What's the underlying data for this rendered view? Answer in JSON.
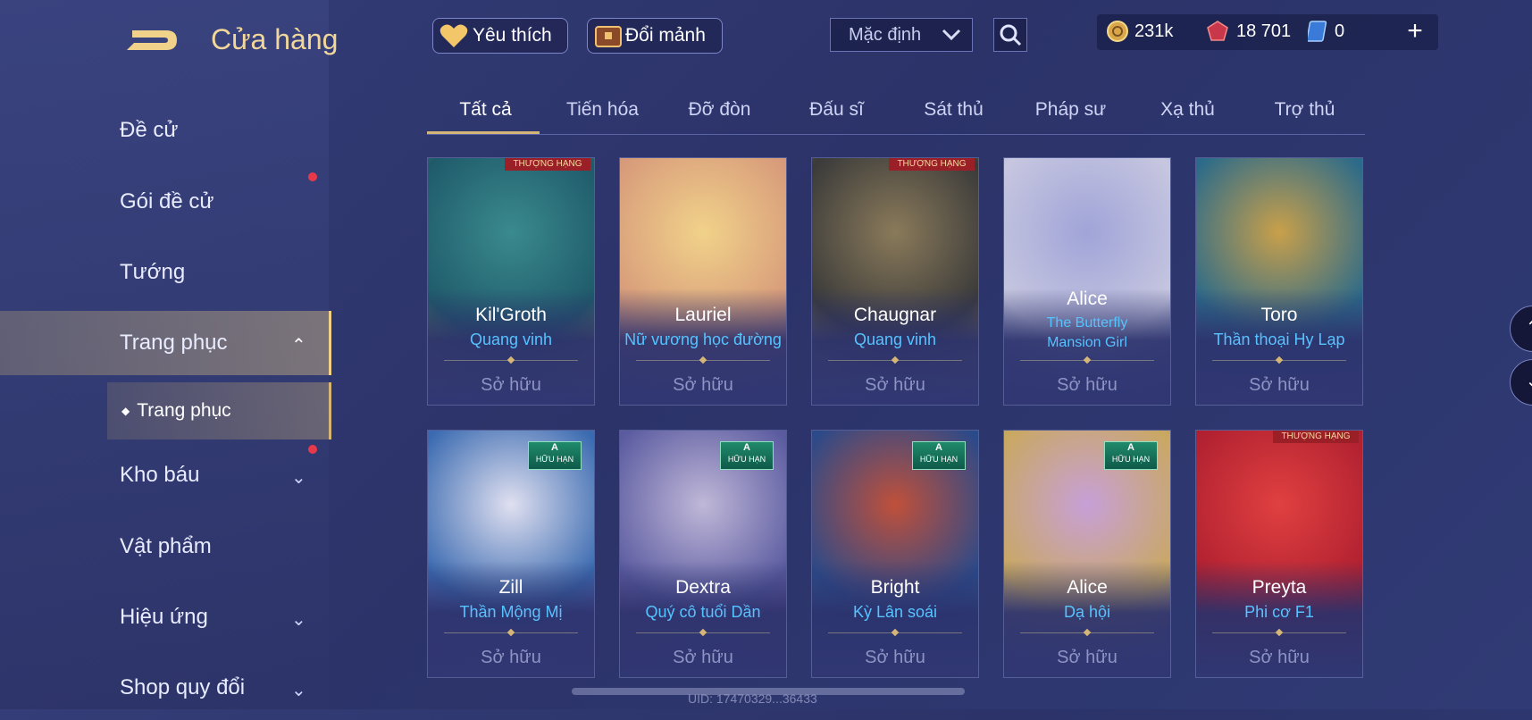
{
  "header": {
    "title": "Cửa hàng",
    "favorites_label": "Yêu thích",
    "exchange_label": "Đổi mảnh",
    "sort_value": "Mặc định"
  },
  "currency": [
    {
      "icon": "gold-coin-icon",
      "value": "231k"
    },
    {
      "icon": "ruby-icon",
      "value": "18 701"
    },
    {
      "icon": "voucher-icon",
      "value": "0"
    }
  ],
  "sidebar": {
    "items": [
      {
        "label": "Đề cử"
      },
      {
        "label": "Gói đề cử"
      },
      {
        "label": "Tướng"
      },
      {
        "label": "Trang phục"
      },
      {
        "label": "Kho báu"
      },
      {
        "label": "Vật phẩm"
      },
      {
        "label": "Hiệu ứng"
      },
      {
        "label": "Shop quy đổi"
      }
    ],
    "sub_item": "Trang phục"
  },
  "tabs": [
    "Tất cả",
    "Tiến hóa",
    "Đỡ đòn",
    "Đấu sĩ",
    "Sát thủ",
    "Pháp sư",
    "Xạ thủ",
    "Trợ thủ"
  ],
  "cards": [
    {
      "name": "Kil'Groth",
      "skin": "Quang vinh",
      "status": "Sở hữu",
      "badge": "THƯỢNG HẠNG",
      "colors": [
        "#1f5a6a",
        "#3a8a8e",
        "#c7a24a"
      ]
    },
    {
      "name": "Lauriel",
      "skin": "Nữ vương học đường",
      "status": "Sở hữu",
      "badge": "",
      "colors": [
        "#d79a7a",
        "#f1d28a",
        "#8a6a9a"
      ]
    },
    {
      "name": "Chaugnar",
      "skin": "Quang vinh",
      "status": "Sở hữu",
      "badge": "THƯỢNG HẠNG",
      "colors": [
        "#3a3a3a",
        "#8a7a5a",
        "#c9b060"
      ]
    },
    {
      "name": "Alice",
      "skin": "The Butterfly Mansion Girl",
      "status": "Sở hữu",
      "badge": "",
      "colors": [
        "#c7c7e0",
        "#a0a4d8",
        "#5a6ab0"
      ]
    },
    {
      "name": "Toro",
      "skin": "Thần thoại Hy Lạp",
      "status": "Sở hữu",
      "badge": "",
      "colors": [
        "#2a6a8a",
        "#c9a04a",
        "#4a5a9a"
      ]
    },
    {
      "name": "Zill",
      "skin": "Thần Mộng Mị",
      "status": "Sở hữu",
      "badge": "HỮU HẠN",
      "colors": [
        "#3a6ab0",
        "#e0e0f0",
        "#8a5ab0"
      ]
    },
    {
      "name": "Dextra",
      "skin": "Quý cô tuổi Dần",
      "status": "Sở hữu",
      "badge": "HỮU HẠN",
      "colors": [
        "#5a5aa0",
        "#c0b8d8",
        "#8a4a8a"
      ]
    },
    {
      "name": "Bright",
      "skin": "Kỳ Lân soái",
      "status": "Sở hữu",
      "badge": "HỮU HẠN",
      "colors": [
        "#2a4a8a",
        "#c0503a",
        "#3a6a9a"
      ]
    },
    {
      "name": "Alice",
      "skin": "Dạ hội",
      "status": "Sở hữu",
      "badge": "HỮU HẠN",
      "colors": [
        "#c9a860",
        "#c7a0d8",
        "#6a6ab0"
      ]
    },
    {
      "name": "Preyta",
      "skin": "Phi cơ F1",
      "status": "Sở hữu",
      "badge": "THƯỢNG HẠNG",
      "colors": [
        "#b02030",
        "#e04040",
        "#6a1a2a"
      ]
    }
  ],
  "uid_text": "UID: 17470329...36433"
}
